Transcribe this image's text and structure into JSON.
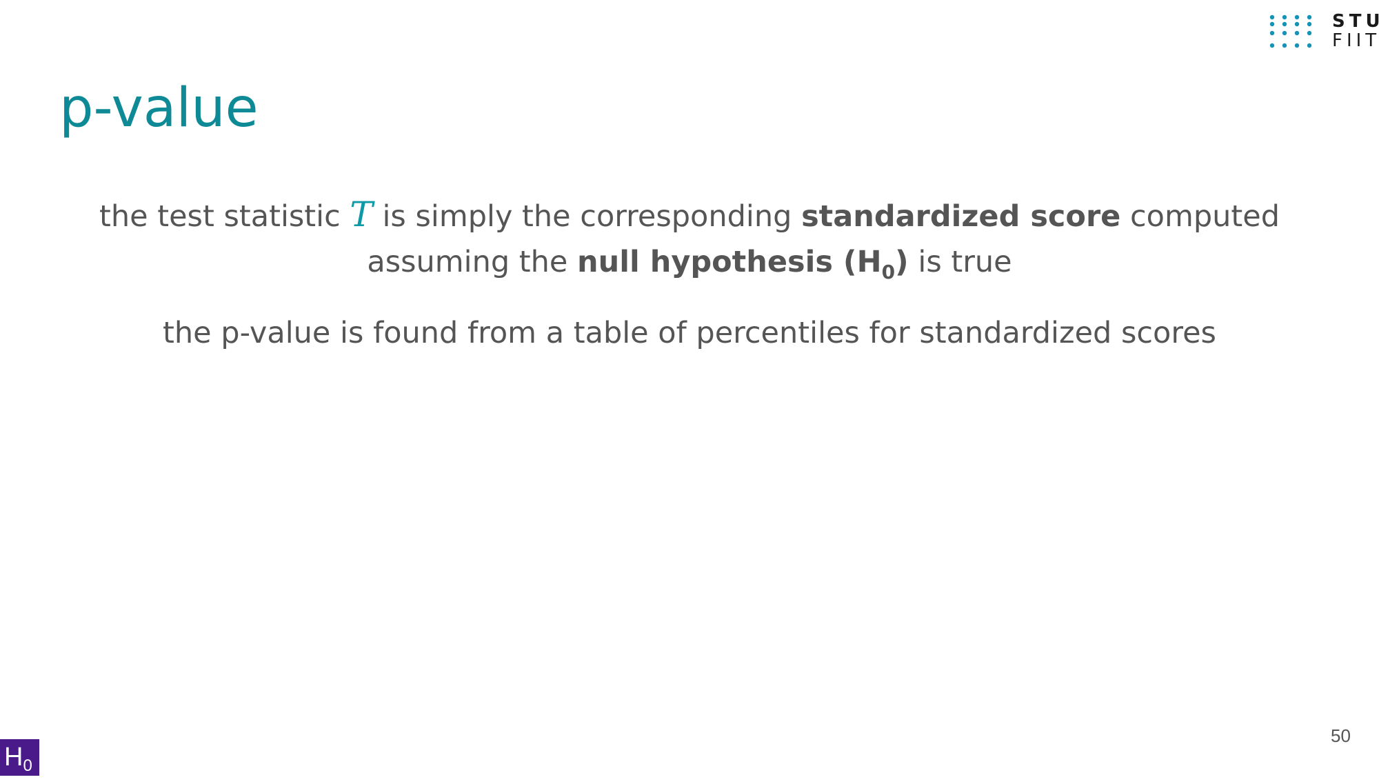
{
  "title": "p-value",
  "logo": {
    "line1": "STU",
    "line2": "FIIT",
    "dot_color": "#1592b8"
  },
  "paragraph1": {
    "part1": "the test statistic ",
    "math_symbol": "T",
    "part2": " is simply the corresponding ",
    "bold1": "standardized score",
    "part3": " computed assuming the ",
    "bold2_text": "null hypothesis (H",
    "bold2_sub": "0",
    "bold2_close": ")",
    "part4": " is true"
  },
  "paragraph2": "the p-value is found from a table of percentiles for standardized scores",
  "page_number": "50",
  "badge": {
    "letter": "H",
    "subscript": "0",
    "color": "#4a1a8a"
  },
  "colors": {
    "accent": "#0d8a96",
    "text": "#555555"
  }
}
